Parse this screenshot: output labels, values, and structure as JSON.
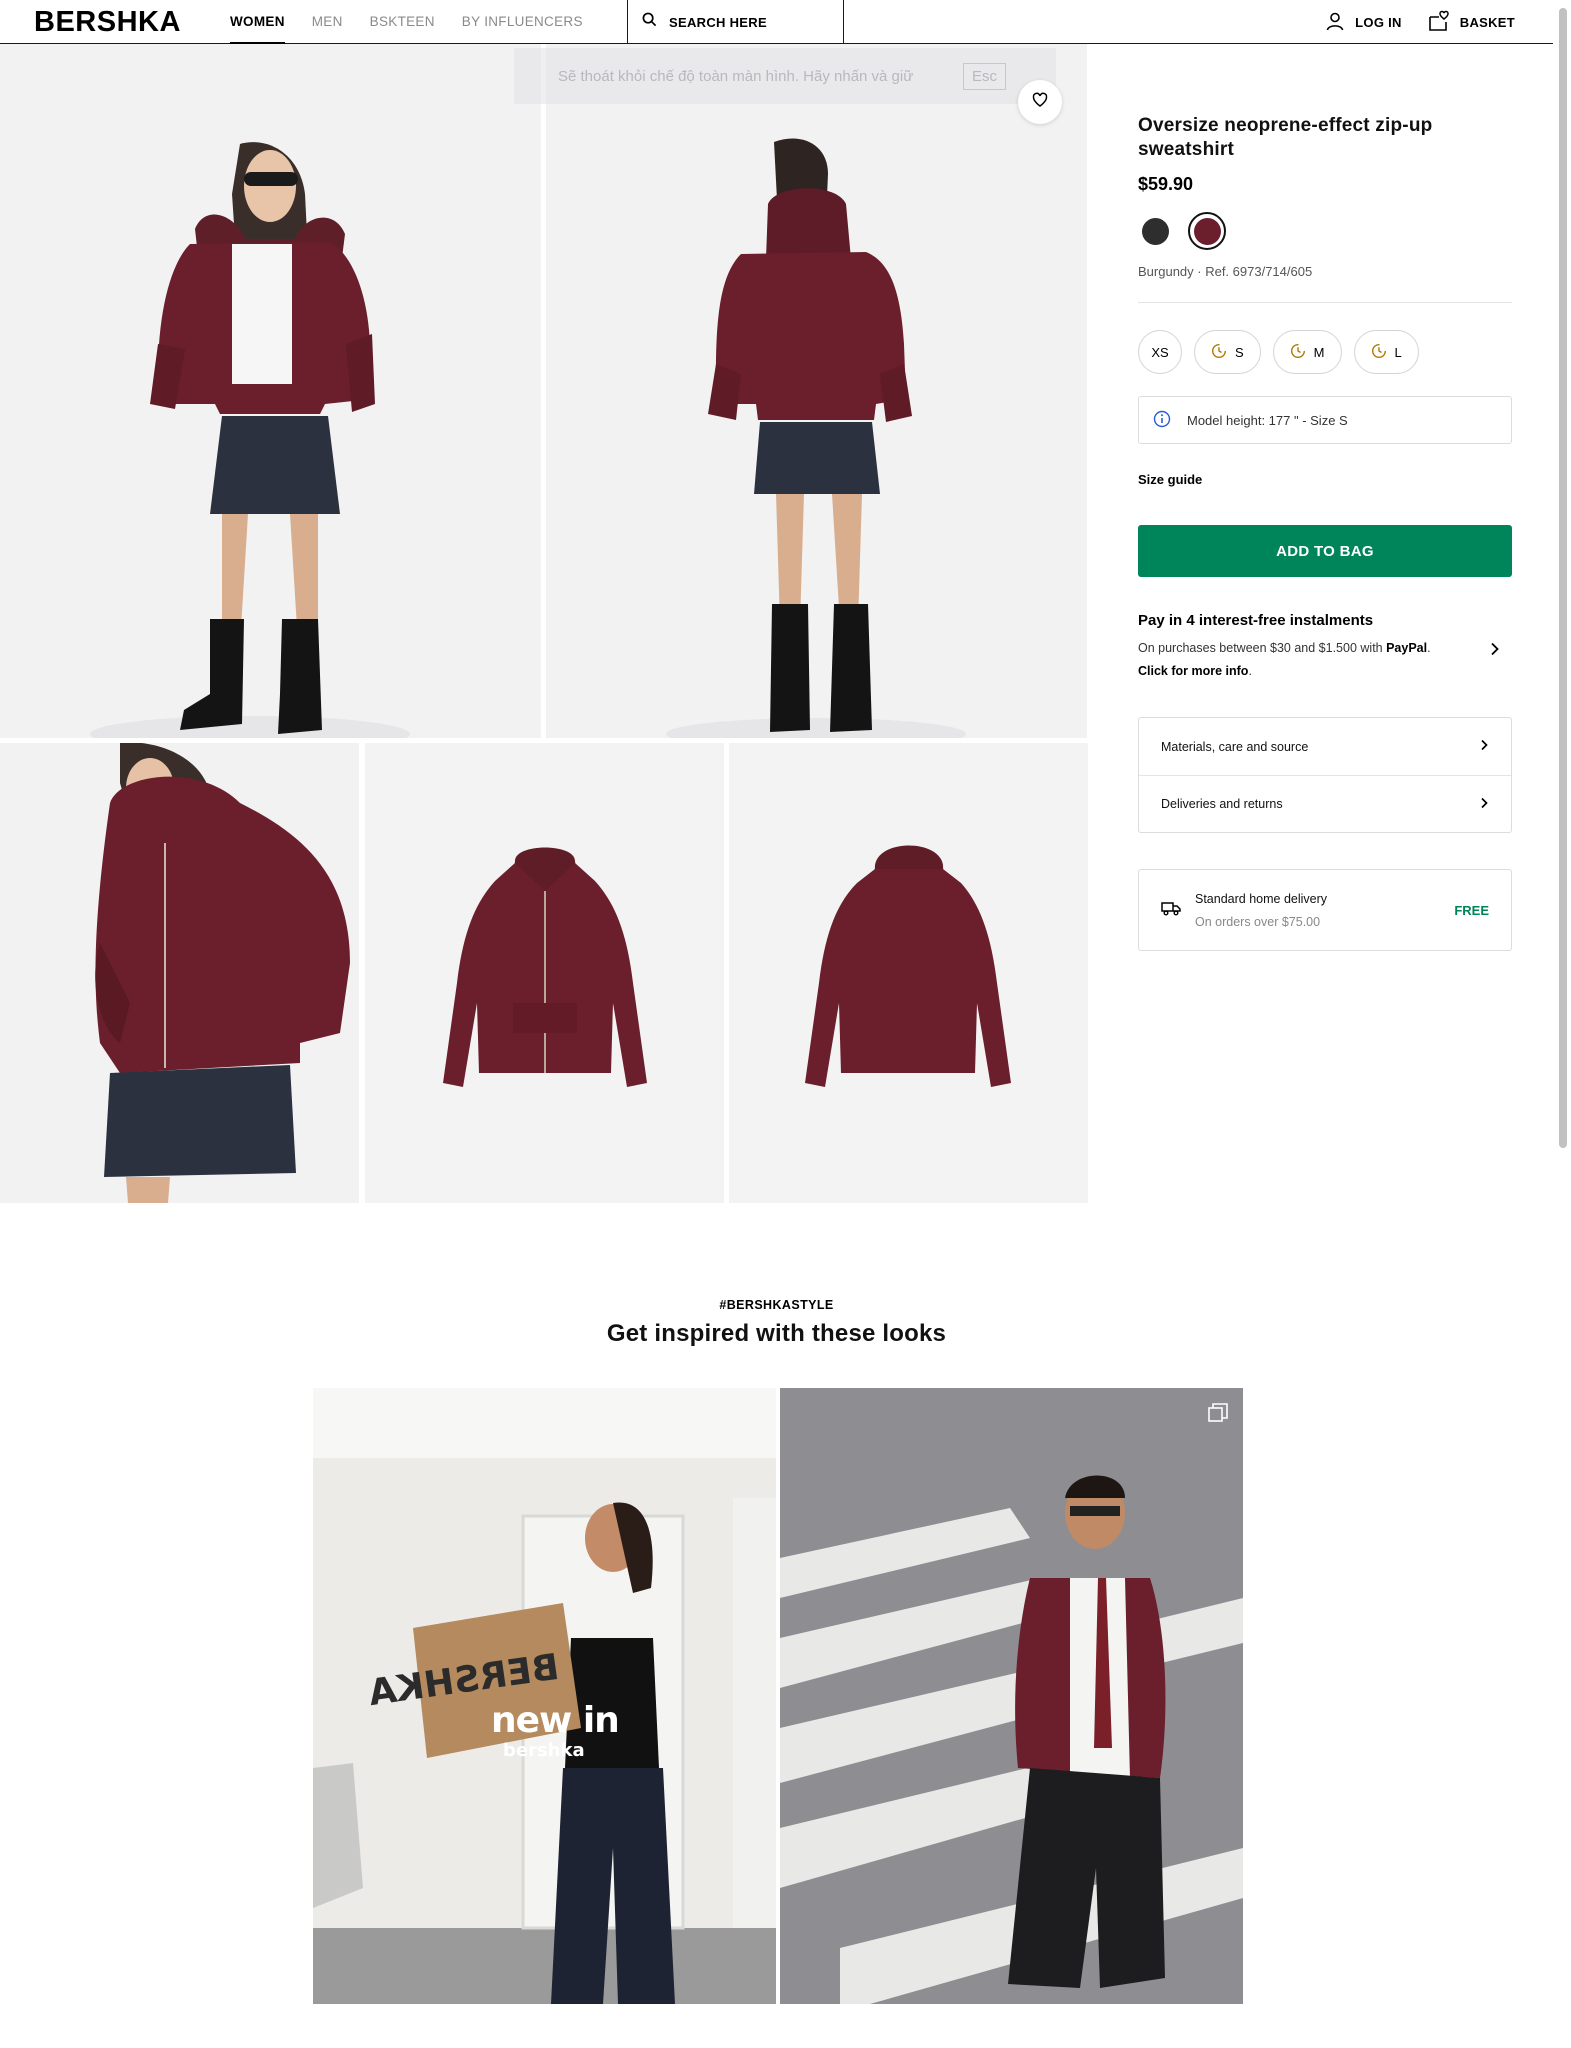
{
  "header": {
    "logo": "BERSHKA",
    "nav": [
      "WOMEN",
      "MEN",
      "BSKTEEN",
      "BY INFLUENCERS"
    ],
    "search_label": "SEARCH HERE",
    "login_label": "LOG IN",
    "basket_label": "BASKET"
  },
  "toast": {
    "text": "Sẽ thoát khỏi chế độ toàn màn hình. Hãy nhấn và giữ",
    "key": "Esc"
  },
  "product": {
    "title": "Oversize neoprene-effect zip-up sweatshirt",
    "price": "$59.90",
    "colors": [
      {
        "name": "black",
        "hex": "#2e2e2e"
      },
      {
        "name": "burgundy",
        "hex": "#6b1f2c",
        "selected": true
      }
    ],
    "color_ref": "Burgundy · Ref. 6973/714/605",
    "sizes": [
      {
        "label": "XS",
        "low_stock": false
      },
      {
        "label": "S",
        "low_stock": true
      },
      {
        "label": "M",
        "low_stock": true
      },
      {
        "label": "L",
        "low_stock": true
      }
    ],
    "model_info": "Model height: 177 \" - Size S",
    "size_guide": "Size guide",
    "add_to_bag": "ADD TO BAG",
    "paypal": {
      "heading": "Pay in 4 interest-free instalments",
      "line1_pre": "On purchases between $30 and $1.500 with ",
      "line1_brand": "PayPal",
      "line1_post": ".",
      "line2": "Click for more info",
      "line2_post": "."
    },
    "accordion": [
      "Materials, care and source",
      "Deliveries and returns"
    ],
    "delivery": {
      "title": "Standard home delivery",
      "subtitle": "On orders over $75.00",
      "badge": "FREE"
    }
  },
  "inspiration": {
    "tag": "#BERSHKASTYLE",
    "title": "Get inspired with these looks",
    "look1_overlay": "new in",
    "look1_overlay_sub": "bershka",
    "bag_print": "BERSHKA"
  },
  "colors": {
    "accent_green": "#00855b",
    "burgundy": "#6b1f2c",
    "denim": "#2c3140"
  }
}
